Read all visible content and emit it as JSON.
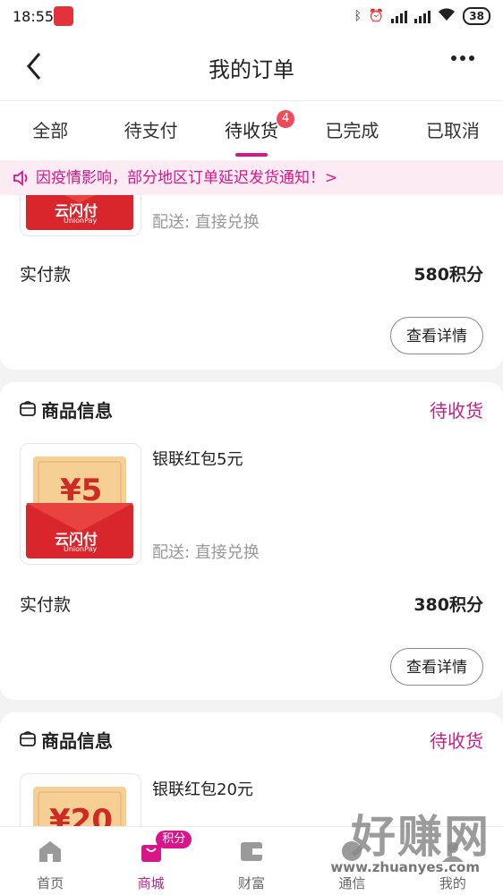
{
  "status_bar": {
    "time": "18:55",
    "battery": "38",
    "network": "HD"
  },
  "header": {
    "title": "我的订单"
  },
  "tabs": [
    {
      "label": "全部"
    },
    {
      "label": "待支付"
    },
    {
      "label": "待收货",
      "badge": "4",
      "active": true
    },
    {
      "label": "已完成"
    },
    {
      "label": "已取消"
    }
  ],
  "notice": {
    "text": "因疫情影响，部分地区订单延迟发货通知！>"
  },
  "orders": [
    {
      "delivery": "配送: 直接兑换",
      "pay_label": "实付款",
      "pay_value": "580积分",
      "detail_button": "查看详情",
      "brand": "云闪付",
      "brand_en": "UnionPay"
    },
    {
      "section_title": "商品信息",
      "status": "待收货",
      "product_name": "银联红包5元",
      "amount": "¥5",
      "delivery": "配送: 直接兑换",
      "pay_label": "实付款",
      "pay_value": "380积分",
      "detail_button": "查看详情",
      "brand": "云闪付",
      "brand_en": "UnionPay"
    },
    {
      "section_title": "商品信息",
      "status": "待收货",
      "product_name": "银联红包20元",
      "amount": "¥20"
    }
  ],
  "bottom_nav": [
    {
      "label": "首页",
      "icon": "home-icon"
    },
    {
      "label": "商城",
      "icon": "shop-bag-icon",
      "badge": "积分",
      "active": true
    },
    {
      "label": "财富",
      "icon": "wallet-icon"
    },
    {
      "label": "通信",
      "icon": "phone-icon"
    },
    {
      "label": "我的",
      "icon": "profile-icon"
    }
  ],
  "watermark": {
    "text": "好赚网",
    "url": "www.zhuanyes.com"
  },
  "colors": {
    "accent": "#d8168a",
    "status": "#c2218a",
    "notice_bg": "#fcebf3",
    "envelope_red": "#d9262c"
  }
}
